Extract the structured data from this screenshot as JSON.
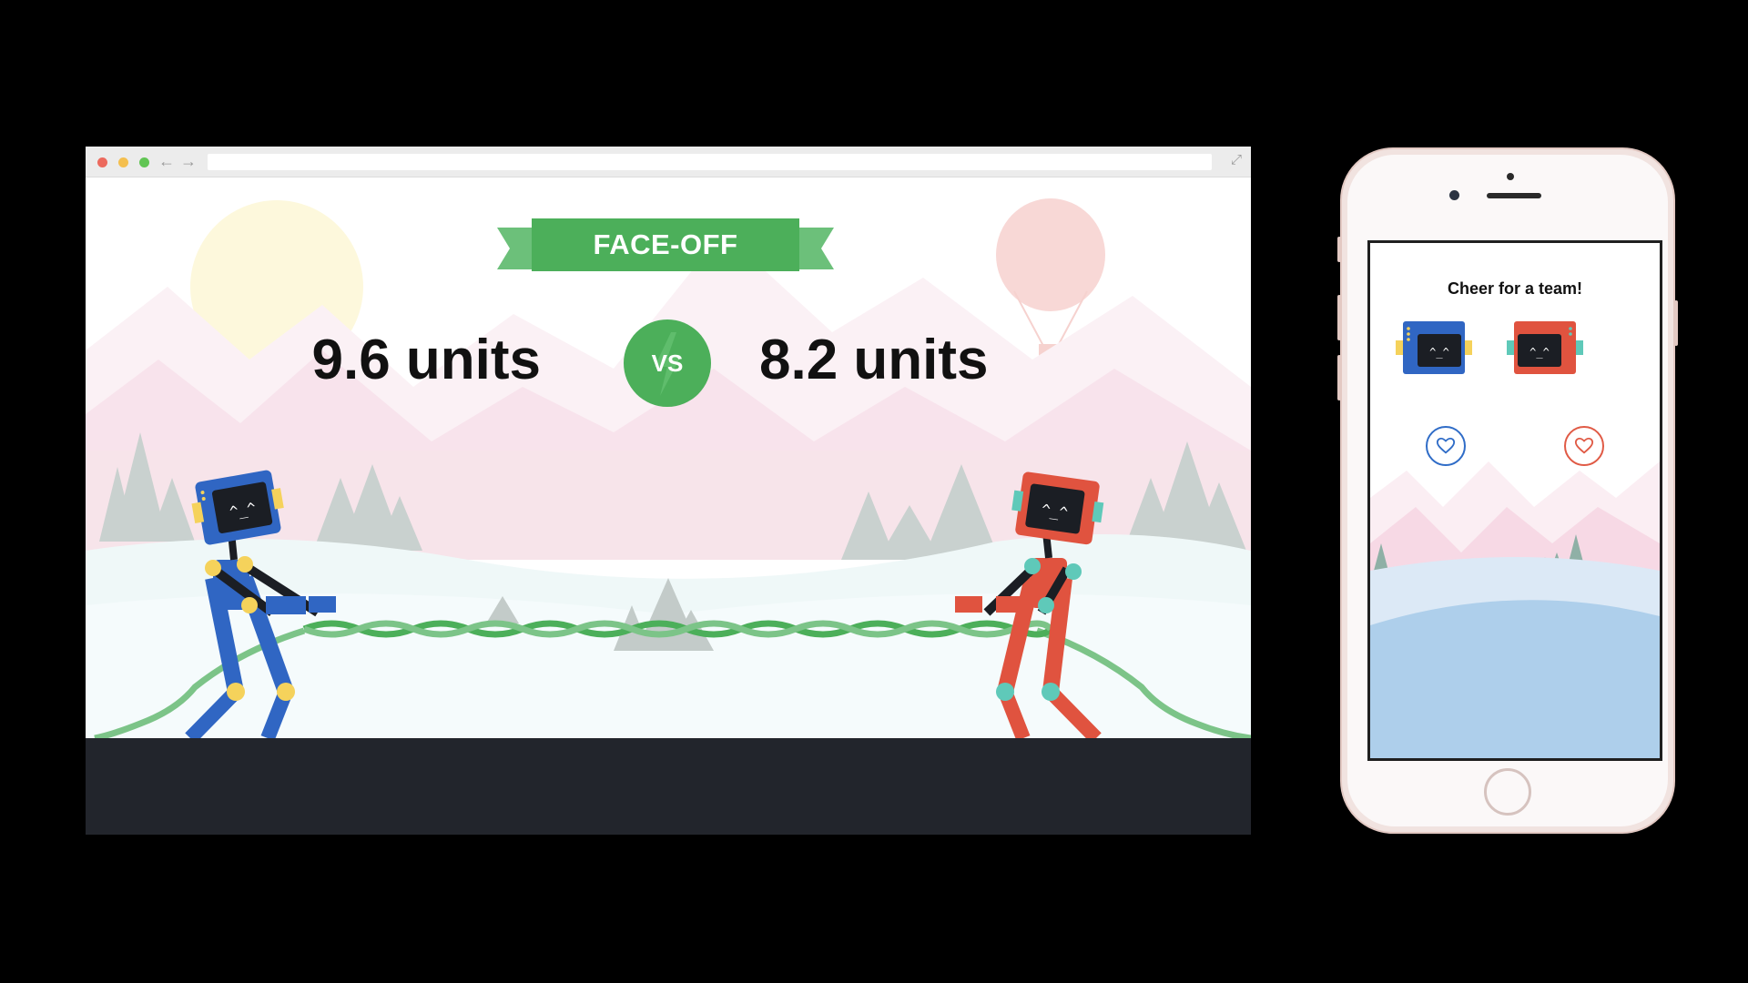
{
  "browser": {
    "nav_back_glyph": "←",
    "nav_forward_glyph": "→",
    "expand_glyph": "⤢",
    "banner_label": "FACE-OFF",
    "left_score": "9.6 units",
    "right_score": "8.2 units",
    "vs_label": "VS",
    "colors": {
      "banner_green": "#4caf5a",
      "blue_robot": "#3066c3",
      "red_robot": "#e0533f",
      "rope_green": "#4caf5a",
      "footer": "#22252c"
    },
    "icons": [
      "close-dot",
      "minimize-dot",
      "maximize-dot",
      "back-arrow-icon",
      "forward-arrow-icon",
      "expand-icon",
      "lightning-icon",
      "sun",
      "hot-air-balloon"
    ]
  },
  "phone": {
    "heading": "Cheer for a team!",
    "teams": [
      {
        "name": "blue",
        "color": "#2f6cc7",
        "icon": "heart-icon"
      },
      {
        "name": "red",
        "color": "#e05a45",
        "icon": "heart-icon"
      }
    ]
  },
  "robot_face": "^_^"
}
